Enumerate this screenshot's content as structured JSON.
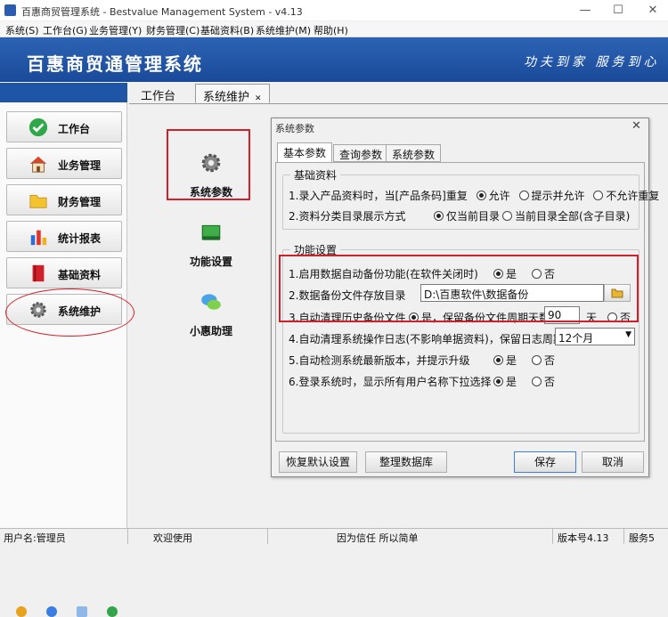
{
  "window": {
    "title": "百惠商贸管理系统 - Bestvalue Management System - v4.13",
    "min": "—",
    "max": "☐",
    "close": "✕"
  },
  "menu": [
    "系统(S)",
    "工作台(G)",
    "业务管理(Y)",
    "财务管理(C)",
    "基础资料(B)",
    "系统维护(M)",
    "帮助(H)"
  ],
  "banner": {
    "title": "百惠商贸通管理系统",
    "slogan": "功夫到家 服务到心"
  },
  "sidebar": {
    "items": [
      {
        "label": "工作台",
        "icon": "check-icon"
      },
      {
        "label": "业务管理",
        "icon": "house-icon"
      },
      {
        "label": "财务管理",
        "icon": "folder-icon"
      },
      {
        "label": "统计报表",
        "icon": "bar-chart-icon"
      },
      {
        "label": "基础资料",
        "icon": "book-icon"
      },
      {
        "label": "系统维护",
        "icon": "gear-icon"
      }
    ]
  },
  "tabs": {
    "workbench": "工作台",
    "maintenance": "系统维护"
  },
  "tiles": [
    {
      "label": "系统参数",
      "icon": "gear-icon"
    },
    {
      "label": "功能设置",
      "icon": "module-icon"
    },
    {
      "label": "小惠助理",
      "icon": "chat-icon"
    }
  ],
  "dialog": {
    "title": "系统参数",
    "close": "✕",
    "tabs": [
      "基本参数",
      "查询参数",
      "系统参数"
    ],
    "basic_group": {
      "legend": "基础资料",
      "row1": {
        "label": "1.录入产品资料时，当[产品条码]重复",
        "opt1": "允许",
        "opt2": "提示并允许",
        "opt3": "不允许重复",
        "selected": 1
      },
      "row2": {
        "label": "2.资料分类目录展示方式",
        "opt1": "仅当前目录",
        "opt2": "当前目录全部(含子目录)",
        "selected": 1
      }
    },
    "func_group": {
      "legend": "功能设置",
      "row1": {
        "label": "1.启用数据自动备份功能(在软件关闭时)",
        "yes": "是",
        "no": "否",
        "selected": "yes"
      },
      "row2": {
        "label": "2.数据备份文件存放目录",
        "path": "D:\\百惠软件\\数据备份"
      },
      "row3": {
        "label": "3.自动清理历史备份文件",
        "yes": "是，保留备份文件周期天数",
        "days": "90",
        "unit": "天",
        "no": "否",
        "selected": "yes"
      },
      "row4": {
        "label": "4.自动清理系统操作日志(不影响单据资料)，保留日志周期",
        "period": "12个月"
      },
      "row5": {
        "label": "5.自动检测系统最新版本，并提示升级",
        "yes": "是",
        "no": "否",
        "selected": "yes"
      },
      "row6": {
        "label": "6.登录系统时，显示所有用户名称下拉选择",
        "yes": "是",
        "no": "否",
        "selected": "yes"
      }
    },
    "buttons": {
      "restore": "恢复默认设置",
      "tidy": "整理数据库",
      "save": "保存",
      "cancel": "取消"
    }
  },
  "status": {
    "user": "用户名:管理员",
    "welcome": "欢迎使用",
    "motto": "因为信任 所以简单",
    "version": "版本号4.13",
    "service": "服务5"
  },
  "colors": {
    "banner": "#1f55a6",
    "highlight": "#d2202a",
    "accent": "#3b7de0"
  }
}
